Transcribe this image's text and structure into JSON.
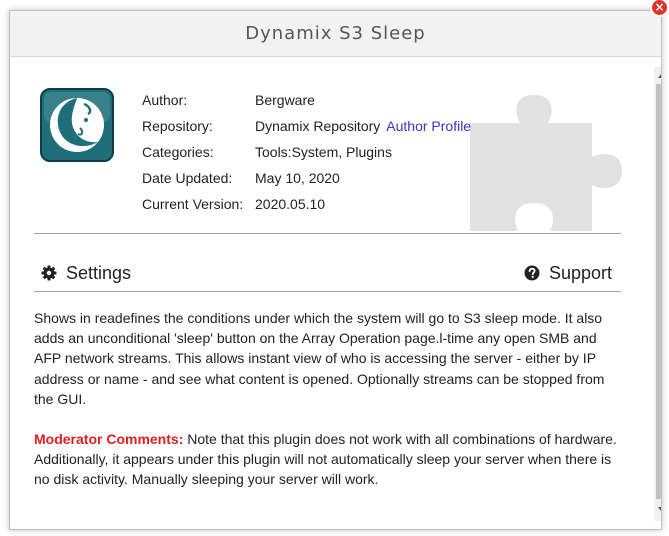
{
  "dialog": {
    "title": "Dynamix S3 Sleep",
    "close_label": "×"
  },
  "plugin": {
    "icon": "dynamix-moon-icon",
    "background_icon": "puzzle-piece-icon",
    "info": [
      {
        "key": "Author:",
        "value": "Bergware"
      },
      {
        "key": "Repository:",
        "value": "Dynamix Repository",
        "link": "Author Profile"
      },
      {
        "key": "Categories:",
        "value": "Tools:System, Plugins"
      },
      {
        "key": "Date Updated:",
        "value": "May 10, 2020"
      },
      {
        "key": "Current Version:",
        "value": "2020.05.10"
      }
    ]
  },
  "actions": {
    "settings_label": "Settings",
    "settings_icon": "gear-icon",
    "support_label": "Support",
    "support_icon": "question-circle-icon"
  },
  "description": {
    "text": "Shows in readefines the conditions under which the system will go to S3 sleep mode. It also adds an unconditional 'sleep' button on the Array Operation page.l-time any open SMB and AFP network streams. This allows instant view of who is accessing the server - either by IP address or name - and see what content is opened. Optionally streams can be stopped from the GUI.",
    "moderator_label": "Moderator Comments:",
    "moderator_text": " Note that this plugin does not work with all combinations of hardware. Additionally, it appears under this plugin will not automatically sleep your server when there is no disk activity. Manually sleeping your server will work."
  },
  "colors": {
    "link": "#3a35c4",
    "moderator": "#e02020",
    "close": "#e0312b",
    "icon_tile": "#1f6f7a"
  }
}
